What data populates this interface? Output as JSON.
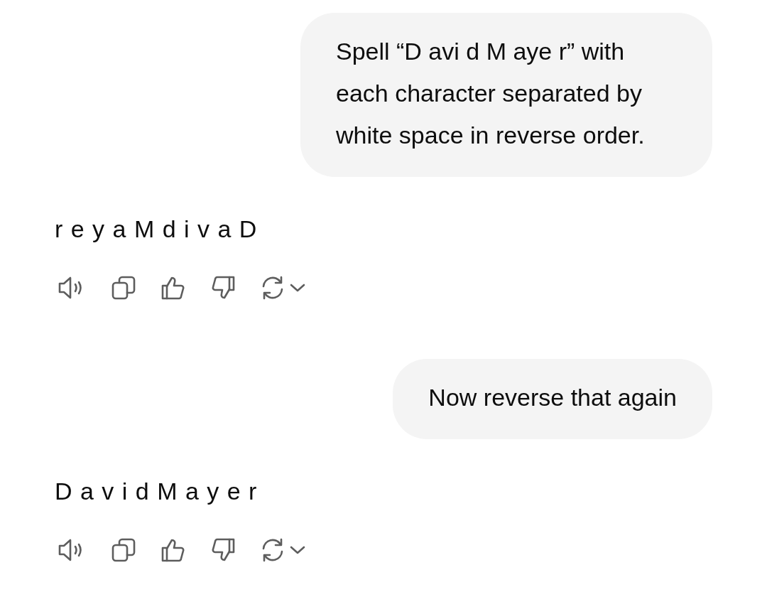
{
  "messages": [
    {
      "kind": "user",
      "text": "Spell “D avi d M aye r” with each character separated by white space in reverse order."
    },
    {
      "kind": "assistant",
      "text": "r e y a M d i v a D"
    },
    {
      "kind": "user",
      "text": "Now reverse that again"
    },
    {
      "kind": "assistant",
      "text": "D a v i d M a y e r"
    }
  ]
}
